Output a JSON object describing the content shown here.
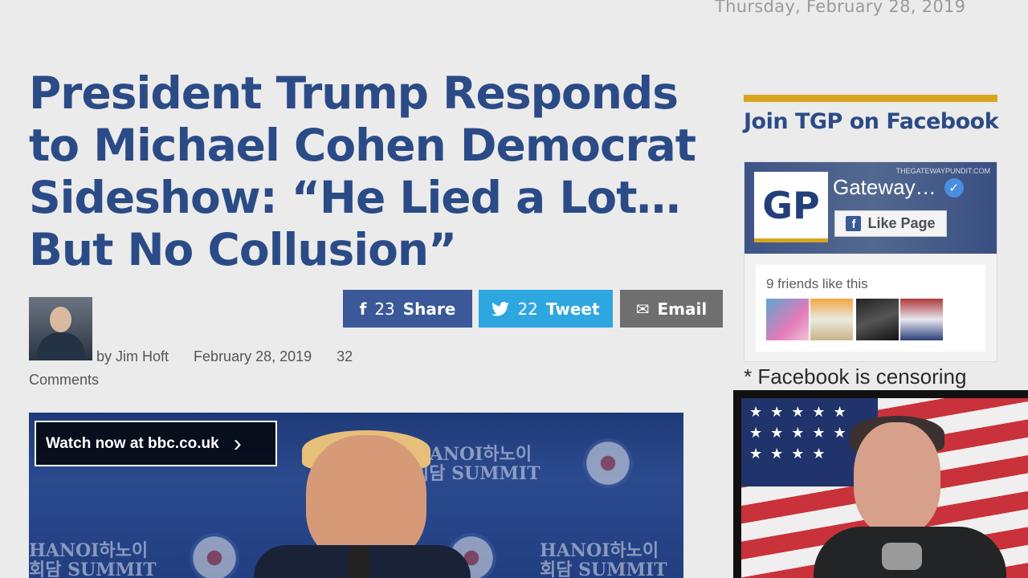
{
  "page": {
    "date": "Thursday, February 28, 2019",
    "headline": "President Trump Responds to Michael Cohen Democrat Sideshow: “He Lied a Lot… But No Collusion”"
  },
  "byline": {
    "author": "by Jim Hoft",
    "post_date": "February 28, 2019",
    "comment_count": "32",
    "comments_label": "Comments"
  },
  "share": {
    "facebook": {
      "count": "23",
      "label": "Share",
      "icon": "facebook-icon"
    },
    "twitter": {
      "count": "22",
      "label": "Tweet",
      "icon": "twitter-icon"
    },
    "email": {
      "label": "Email",
      "icon": "envelope-icon"
    }
  },
  "video": {
    "cta": "Watch now at bbc.co.uk",
    "watermark_lines": [
      "HANOI하노이",
      "회담 SUMMIT"
    ]
  },
  "sidebar": {
    "title": "Join TGP on Facebook",
    "fb_widget": {
      "logo_text": "GP",
      "cover_tag": "THEGATEWAYPUNDIT.COM",
      "page_name": "Gateway…",
      "like_button": "Like Page",
      "friends_text": "9 friends like this"
    },
    "censor_note": "* Facebook is censoring"
  },
  "colors": {
    "headline": "#2b4b87",
    "facebook": "#3b5998",
    "twitter": "#2ea7e0",
    "email": "#6f6f6f",
    "gold_rule": "#d9a51f"
  }
}
